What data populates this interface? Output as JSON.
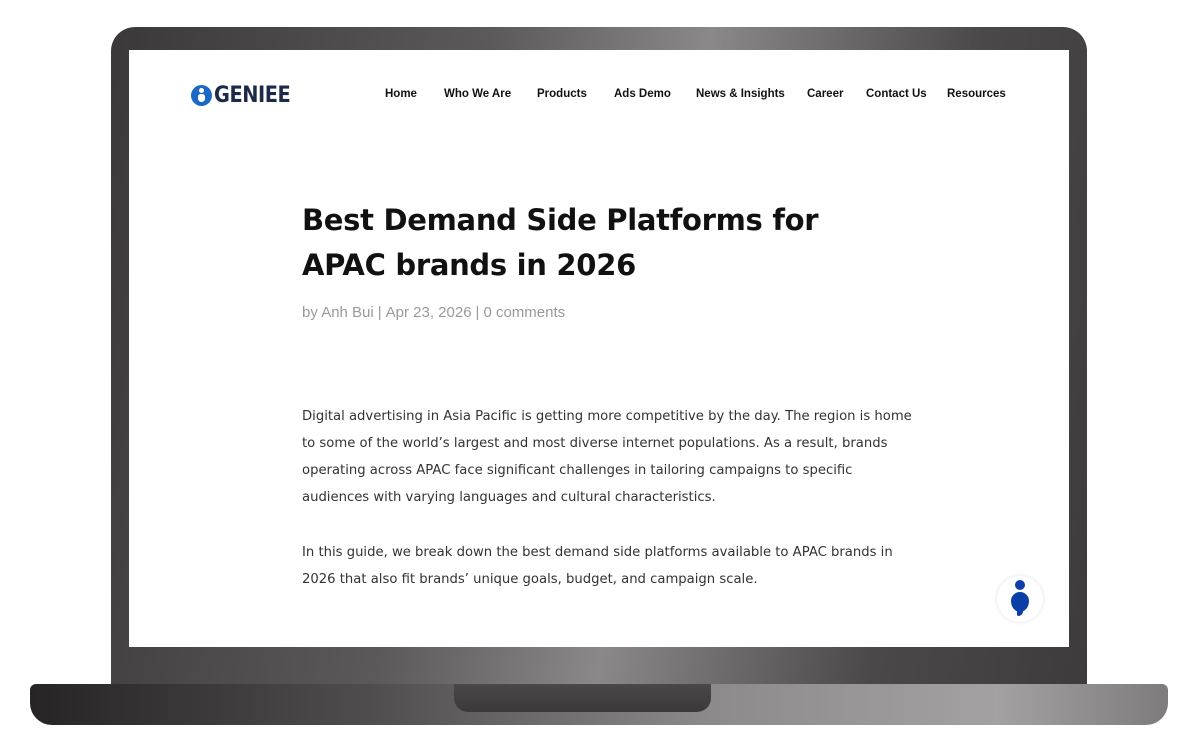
{
  "brand": {
    "name": "GENIEE"
  },
  "nav": [
    {
      "label": "Home"
    },
    {
      "label": "Who We Are"
    },
    {
      "label": "Products"
    },
    {
      "label": "Ads Demo"
    },
    {
      "label": "News & Insights"
    },
    {
      "label": "Career"
    },
    {
      "label": "Contact Us"
    },
    {
      "label": "Resources"
    }
  ],
  "article": {
    "title": "Best Demand Side Platforms for APAC brands in 2026",
    "meta": {
      "by": "by",
      "author": "Anh Bui",
      "date": "Apr 23, 2026",
      "comments": "0 comments"
    },
    "paragraphs": [
      "Digital advertising in Asia Pacific is getting more competitive by the day. The region is home to some of the world’s largest and most diverse internet populations. As a result, brands operating across APAC face significant challenges in tailoring campaigns to specific audiences with varying languages and cultural characteristics.",
      "In this guide, we break down the best demand side platforms available to APAC brands in 2026 that also fit brands’ unique goals, budget, and campaign scale."
    ]
  },
  "colors": {
    "brand_blue": "#1d67c6",
    "widget_blue": "#0a3fa8",
    "meta_gray": "#9a9a9a"
  },
  "icons": {
    "logo": "geniee-logo-icon",
    "widget": "chat-widget-icon"
  }
}
